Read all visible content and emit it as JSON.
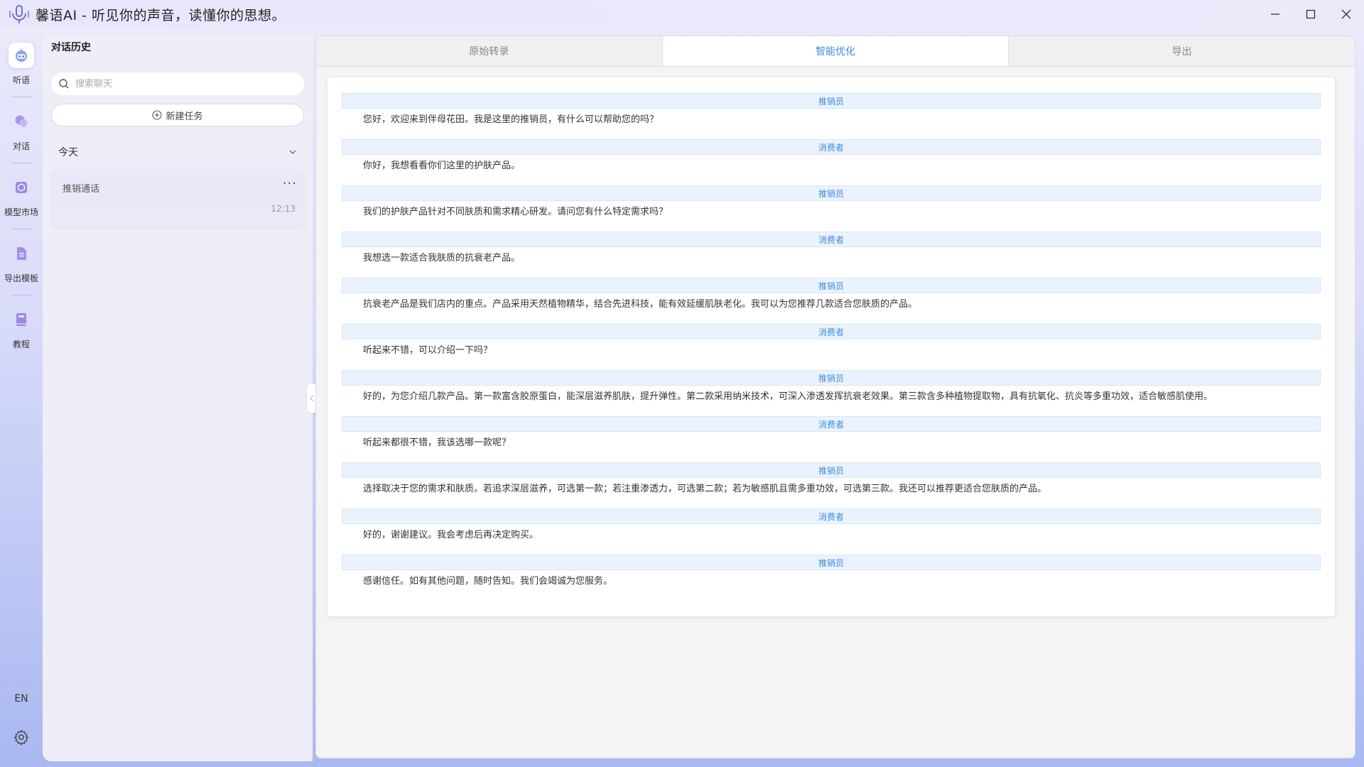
{
  "app": {
    "title": "馨语AI - 听见你的声音，读懂你的思想。"
  },
  "nav": {
    "items": [
      {
        "label": "听语",
        "icon": "robot-icon"
      },
      {
        "label": "对话",
        "icon": "chat-bubbles-icon"
      },
      {
        "label": "模型市场",
        "icon": "cube-icon"
      },
      {
        "label": "导出模板",
        "icon": "document-icon"
      },
      {
        "label": "教程",
        "icon": "book-icon"
      }
    ],
    "active_index": 0,
    "lang": "EN"
  },
  "history": {
    "title": "对话历史",
    "search_placeholder": "搜索聊天",
    "new_task": "新建任务",
    "group": "今天",
    "conversations": [
      {
        "title": "推销通话",
        "time": "12:13"
      }
    ]
  },
  "tabs": [
    {
      "label": "原始转录",
      "active": false
    },
    {
      "label": "智能优化",
      "active": true
    },
    {
      "label": "导出",
      "active": false
    }
  ],
  "transcript": [
    {
      "speaker": "推销员",
      "text": "您好，欢迎来到伴母花田。我是这里的推销员，有什么可以帮助您的吗？"
    },
    {
      "speaker": "消费者",
      "text": "你好，我想看看你们这里的护肤产品。"
    },
    {
      "speaker": "推销员",
      "text": "我们的护肤产品针对不同肤质和需求精心研发。请问您有什么特定需求吗？"
    },
    {
      "speaker": "消费者",
      "text": "我想选一款适合我肤质的抗衰老产品。"
    },
    {
      "speaker": "推销员",
      "text": "抗衰老产品是我们店内的重点。产品采用天然植物精华，结合先进科技，能有效延缓肌肤老化。我可以为您推荐几款适合您肤质的产品。"
    },
    {
      "speaker": "消费者",
      "text": "听起来不错，可以介绍一下吗？"
    },
    {
      "speaker": "推销员",
      "text": "好的，为您介绍几款产品。第一款富含胶原蛋白，能深层滋养肌肤，提升弹性。第二款采用纳米技术，可深入渗透发挥抗衰老效果。第三款含多种植物提取物，具有抗氧化、抗炎等多重功效，适合敏感肌使用。"
    },
    {
      "speaker": "消费者",
      "text": "听起来都很不错，我该选哪一款呢？"
    },
    {
      "speaker": "推销员",
      "text": "选择取决于您的需求和肤质。若追求深层滋养，可选第一款；若注重渗透力，可选第二款；若为敏感肌且需多重功效，可选第三款。我还可以推荐更适合您肤质的产品。"
    },
    {
      "speaker": "消费者",
      "text": "好的，谢谢建议。我会考虑后再决定购买。"
    },
    {
      "speaker": "推销员",
      "text": "感谢信任。如有其他问题，随时告知。我们会竭诚为您服务。"
    }
  ],
  "colors": {
    "accent": "#3e8be0",
    "speaker_bg": "#eaf3fd",
    "nav_icon": "#8a7bd8"
  }
}
